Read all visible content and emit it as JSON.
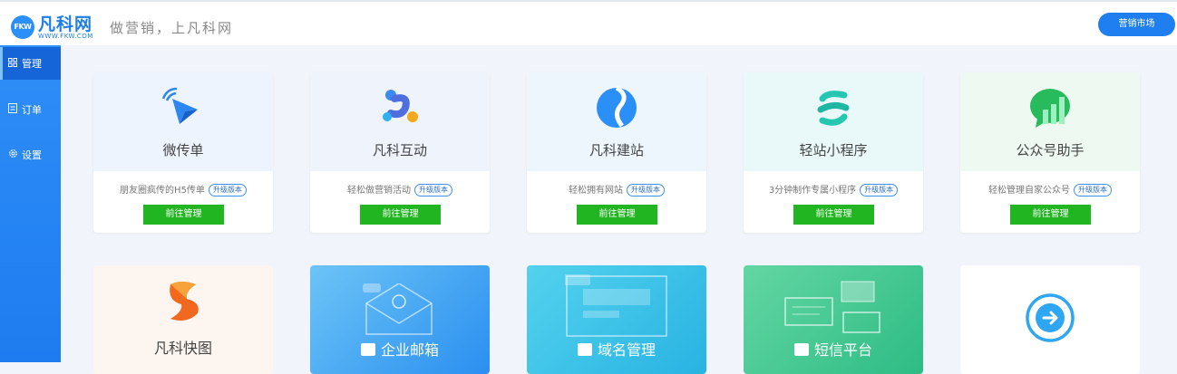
{
  "header": {
    "logo_mark": "FKW",
    "logo_name": "凡科网",
    "logo_url": "WWW.FKW.COM",
    "slogan": "做营销，上凡科网",
    "market_button": "营销市场"
  },
  "sidebar": {
    "items": [
      {
        "icon": "grid-icon",
        "label": "管理",
        "active": true
      },
      {
        "icon": "order-icon",
        "label": "订单",
        "active": false
      },
      {
        "icon": "settings-icon",
        "label": "设置",
        "active": false
      }
    ]
  },
  "products": [
    {
      "icon": "send-arrow-icon",
      "title": "微传单",
      "desc": "朋友圈疯传的H5传单",
      "badge": "升级版本",
      "button": "前往管理",
      "bg": "#eef4fd"
    },
    {
      "icon": "interaction-icon",
      "title": "凡科互动",
      "desc": "轻松做营销活动",
      "badge": "升级版本",
      "button": "前往管理",
      "bg": "#eef3fc"
    },
    {
      "icon": "site-icon",
      "title": "凡科建站",
      "desc": "轻松拥有网站",
      "badge": "升级版本",
      "button": "前往管理",
      "bg": "#edf6fd"
    },
    {
      "icon": "mini-program-icon",
      "title": "轻站小程序",
      "desc": "3分钟制作专属小程序",
      "badge": "升级版本",
      "button": "前往管理",
      "bg": "#e9f8f8"
    },
    {
      "icon": "official-account-icon",
      "title": "公众号助手",
      "desc": "轻松管理自家公众号",
      "badge": "升级版本",
      "button": "前往管理",
      "bg": "#eef9f1"
    }
  ],
  "services": [
    {
      "icon": "quick-image-icon",
      "title": "凡科快图",
      "style": "light"
    },
    {
      "icon": "mail-icon",
      "title": "企业邮箱",
      "style": "blue"
    },
    {
      "icon": "domain-icon",
      "title": "域名管理",
      "style": "cyan"
    },
    {
      "icon": "sms-icon",
      "title": "短信平台",
      "style": "green"
    },
    {
      "icon": "arrow-right-circle-icon",
      "title": "",
      "style": "white"
    }
  ],
  "colors": {
    "primary": "#1f7ff0",
    "button_green": "#22b522",
    "sidebar": "#2f8ef7"
  }
}
